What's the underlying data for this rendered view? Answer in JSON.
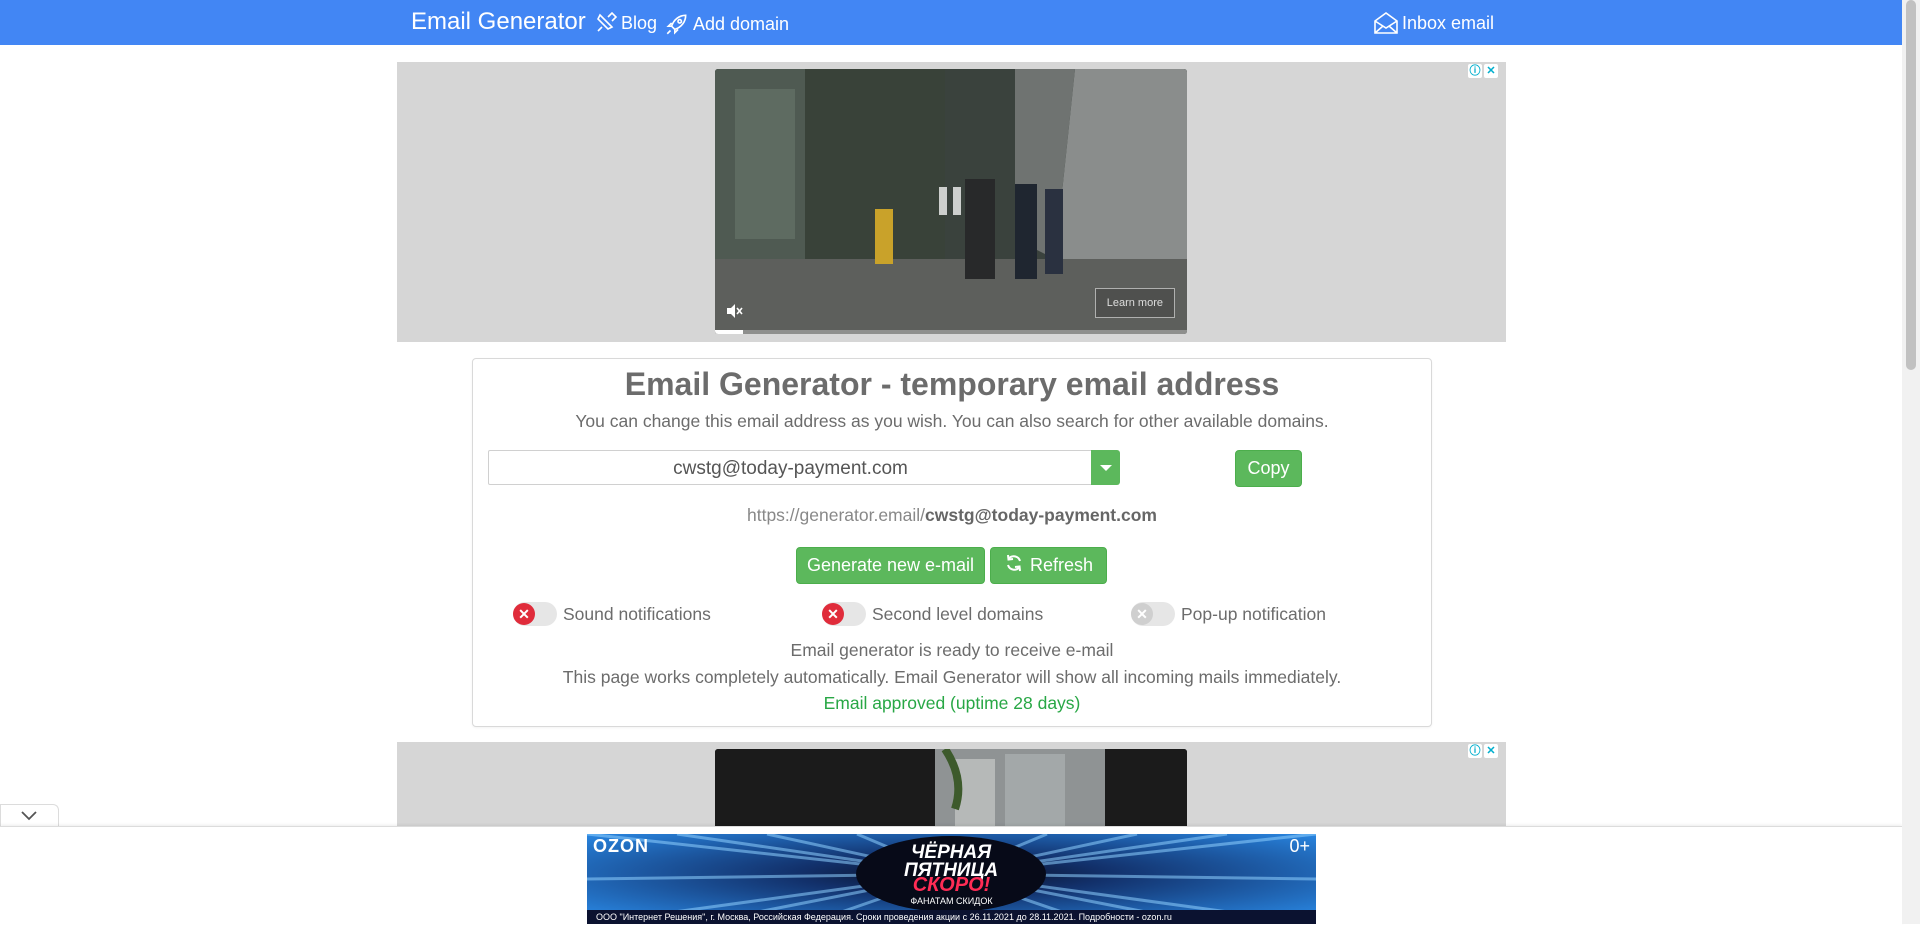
{
  "navbar": {
    "brand": "Email Generator",
    "blog": "Blog",
    "add_domain": "Add domain",
    "inbox": "Inbox email",
    "bg_color": "#4286f4"
  },
  "ad_top": {
    "learn_more": "Learn more",
    "choices_info": "ⓘ",
    "choices_close": "✕",
    "progress": 0.06
  },
  "card": {
    "title": "Email Generator - temporary email address",
    "subtitle": "You can change this email address as you wish. You can also search for other available domains.",
    "email_value": "cwstg@today-payment.com",
    "copy_label": "Copy",
    "url_prefix": "https://generator.email/",
    "url_email": "cwstg@today-payment.com",
    "generate_label": "Generate new e-mail",
    "refresh_label": "Refresh",
    "toggles": [
      {
        "label": "Sound notifications",
        "state": "off"
      },
      {
        "label": "Second level domains",
        "state": "off"
      },
      {
        "label": "Pop-up notification",
        "state": "disabled"
      }
    ],
    "status_ready": "Email generator is ready to receive e-mail",
    "status_auto": "This page works completely automatically. Email Generator will show all incoming mails immediately.",
    "status_approved": "Email approved (uptime 28 days)",
    "accent_color": "#5cb85c"
  },
  "ad_bottom": {
    "choices_info": "ⓘ",
    "choices_close": "✕"
  },
  "ozon_banner": {
    "logo": "OZON",
    "age": "0+",
    "headline": "ЧЁРНАЯ ПЯТНИЦА",
    "soon": "СКОРО!",
    "tagline": "ФАНАТАМ СКИДОК",
    "legal": "ООО \"Интернет Решения\", г. Москва, Российская Федерация. Сроки проведения акции с 26.11.2021 до 28.11.2021. Подробности - ozon.ru"
  }
}
